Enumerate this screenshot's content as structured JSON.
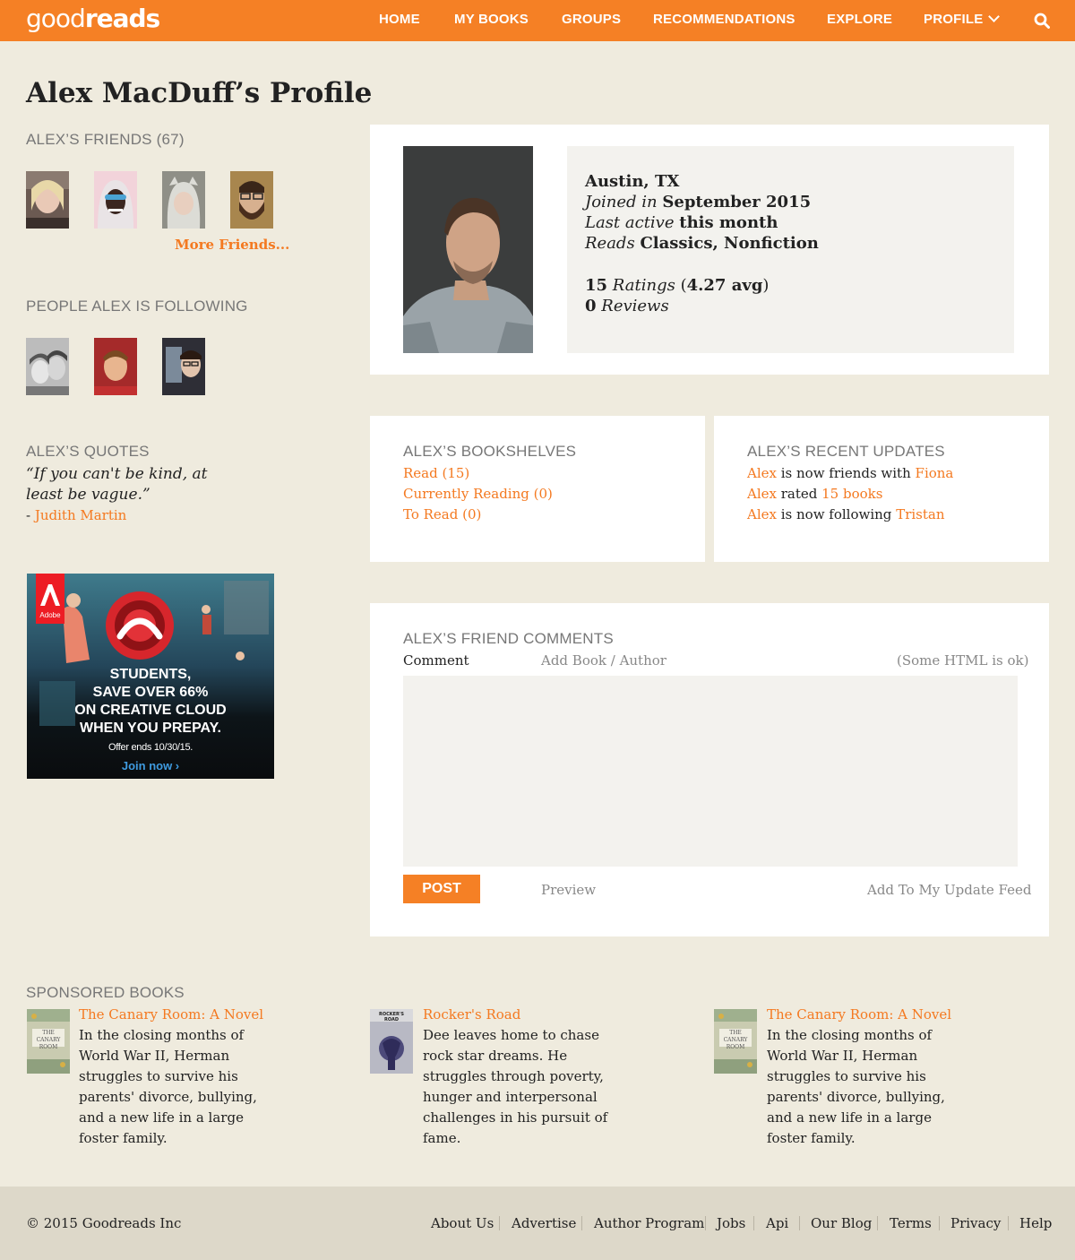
{
  "header": {
    "logo_light": "good",
    "logo_bold": "reads",
    "nav": [
      "HOME",
      "MY BOOKS",
      "GROUPS",
      "RECOMMENDATIONS",
      "EXPLORE",
      "PROFILE"
    ]
  },
  "page_title": "Alex MacDuff’s Profile",
  "friends": {
    "heading": "ALEX’S FRIENDS (67)",
    "more_label": "More Friends..."
  },
  "following": {
    "heading": "PEOPLE ALEX IS FOLLOWING"
  },
  "quotes": {
    "heading": "ALEX’S QUOTES",
    "text": "“If you can't be kind, at least be vague.”",
    "author_prefix": "- ",
    "author": "Judith Martin"
  },
  "ad": {
    "brand": "Adobe",
    "line1": "STUDENTS,",
    "line2": "SAVE OVER 66%",
    "line3": "ON CREATIVE CLOUD",
    "line4": "WHEN YOU PREPAY.",
    "offer": "Offer ends 10/30/15.",
    "cta": "Join now ›"
  },
  "profile": {
    "location": "Austin, TX",
    "joined_label": "Joined in",
    "joined_value": "September 2015",
    "active_label": "Last active",
    "active_value": "this month",
    "reads_label": "Reads",
    "reads_value": "Classics, Nonfiction",
    "ratings_count": "15",
    "ratings_label": "Ratings",
    "ratings_avg": "4.27 avg",
    "reviews_count": "0",
    "reviews_label": "Reviews"
  },
  "bookshelves": {
    "heading": "ALEX’S BOOKSHELVES",
    "items": [
      "Read (15)",
      "Currently Reading (0)",
      "To Read (0)"
    ]
  },
  "updates": {
    "heading": "ALEX’S RECENT UPDATES",
    "items": [
      {
        "actor": "Alex",
        "text": " is now friends with ",
        "object": "Fiona"
      },
      {
        "actor": "Alex",
        "text": " rated ",
        "object": "15 books"
      },
      {
        "actor": "Alex",
        "text": " is now following ",
        "object": "Tristan"
      }
    ]
  },
  "comments": {
    "heading": "ALEX’S FRIEND COMMENTS",
    "comment_label": "Comment",
    "add_book_label": "Add Book / Author",
    "html_note": "(Some HTML is ok)",
    "post_label": "POST",
    "preview_label": "Preview",
    "feed_label": "Add To My Update Feed"
  },
  "sponsored": {
    "heading": "SPONSORED BOOKS",
    "books": [
      {
        "title": "The Canary Room: A Novel",
        "description": "In the closing months of World War II, Herman struggles to survive his parents' divorce, bullying, and a new life in a large foster family.",
        "cover_text": "THE CANARY ROOM"
      },
      {
        "title": "Rocker's Road",
        "description": "Dee leaves home to chase rock star dreams. He struggles through poverty, hunger and interpersonal challenges in his pursuit of fame.",
        "cover_text": "ROCKER'S ROAD"
      },
      {
        "title": "The Canary Room: A Novel",
        "description": "In the closing months of World War II, Herman struggles to survive his parents' divorce, bullying, and a new life in a large foster family.",
        "cover_text": "THE CANARY ROOM"
      }
    ]
  },
  "footer": {
    "copyright": "© 2015 Goodreads Inc",
    "links": [
      "About Us",
      "Advertise",
      "Author Program",
      "Jobs",
      "Api",
      "Our Blog",
      "Terms",
      "Privacy",
      "Help"
    ]
  },
  "colors": {
    "brand_orange": "#f58025",
    "page_bg": "#efebde",
    "footer_bg": "#ddd8c9"
  }
}
